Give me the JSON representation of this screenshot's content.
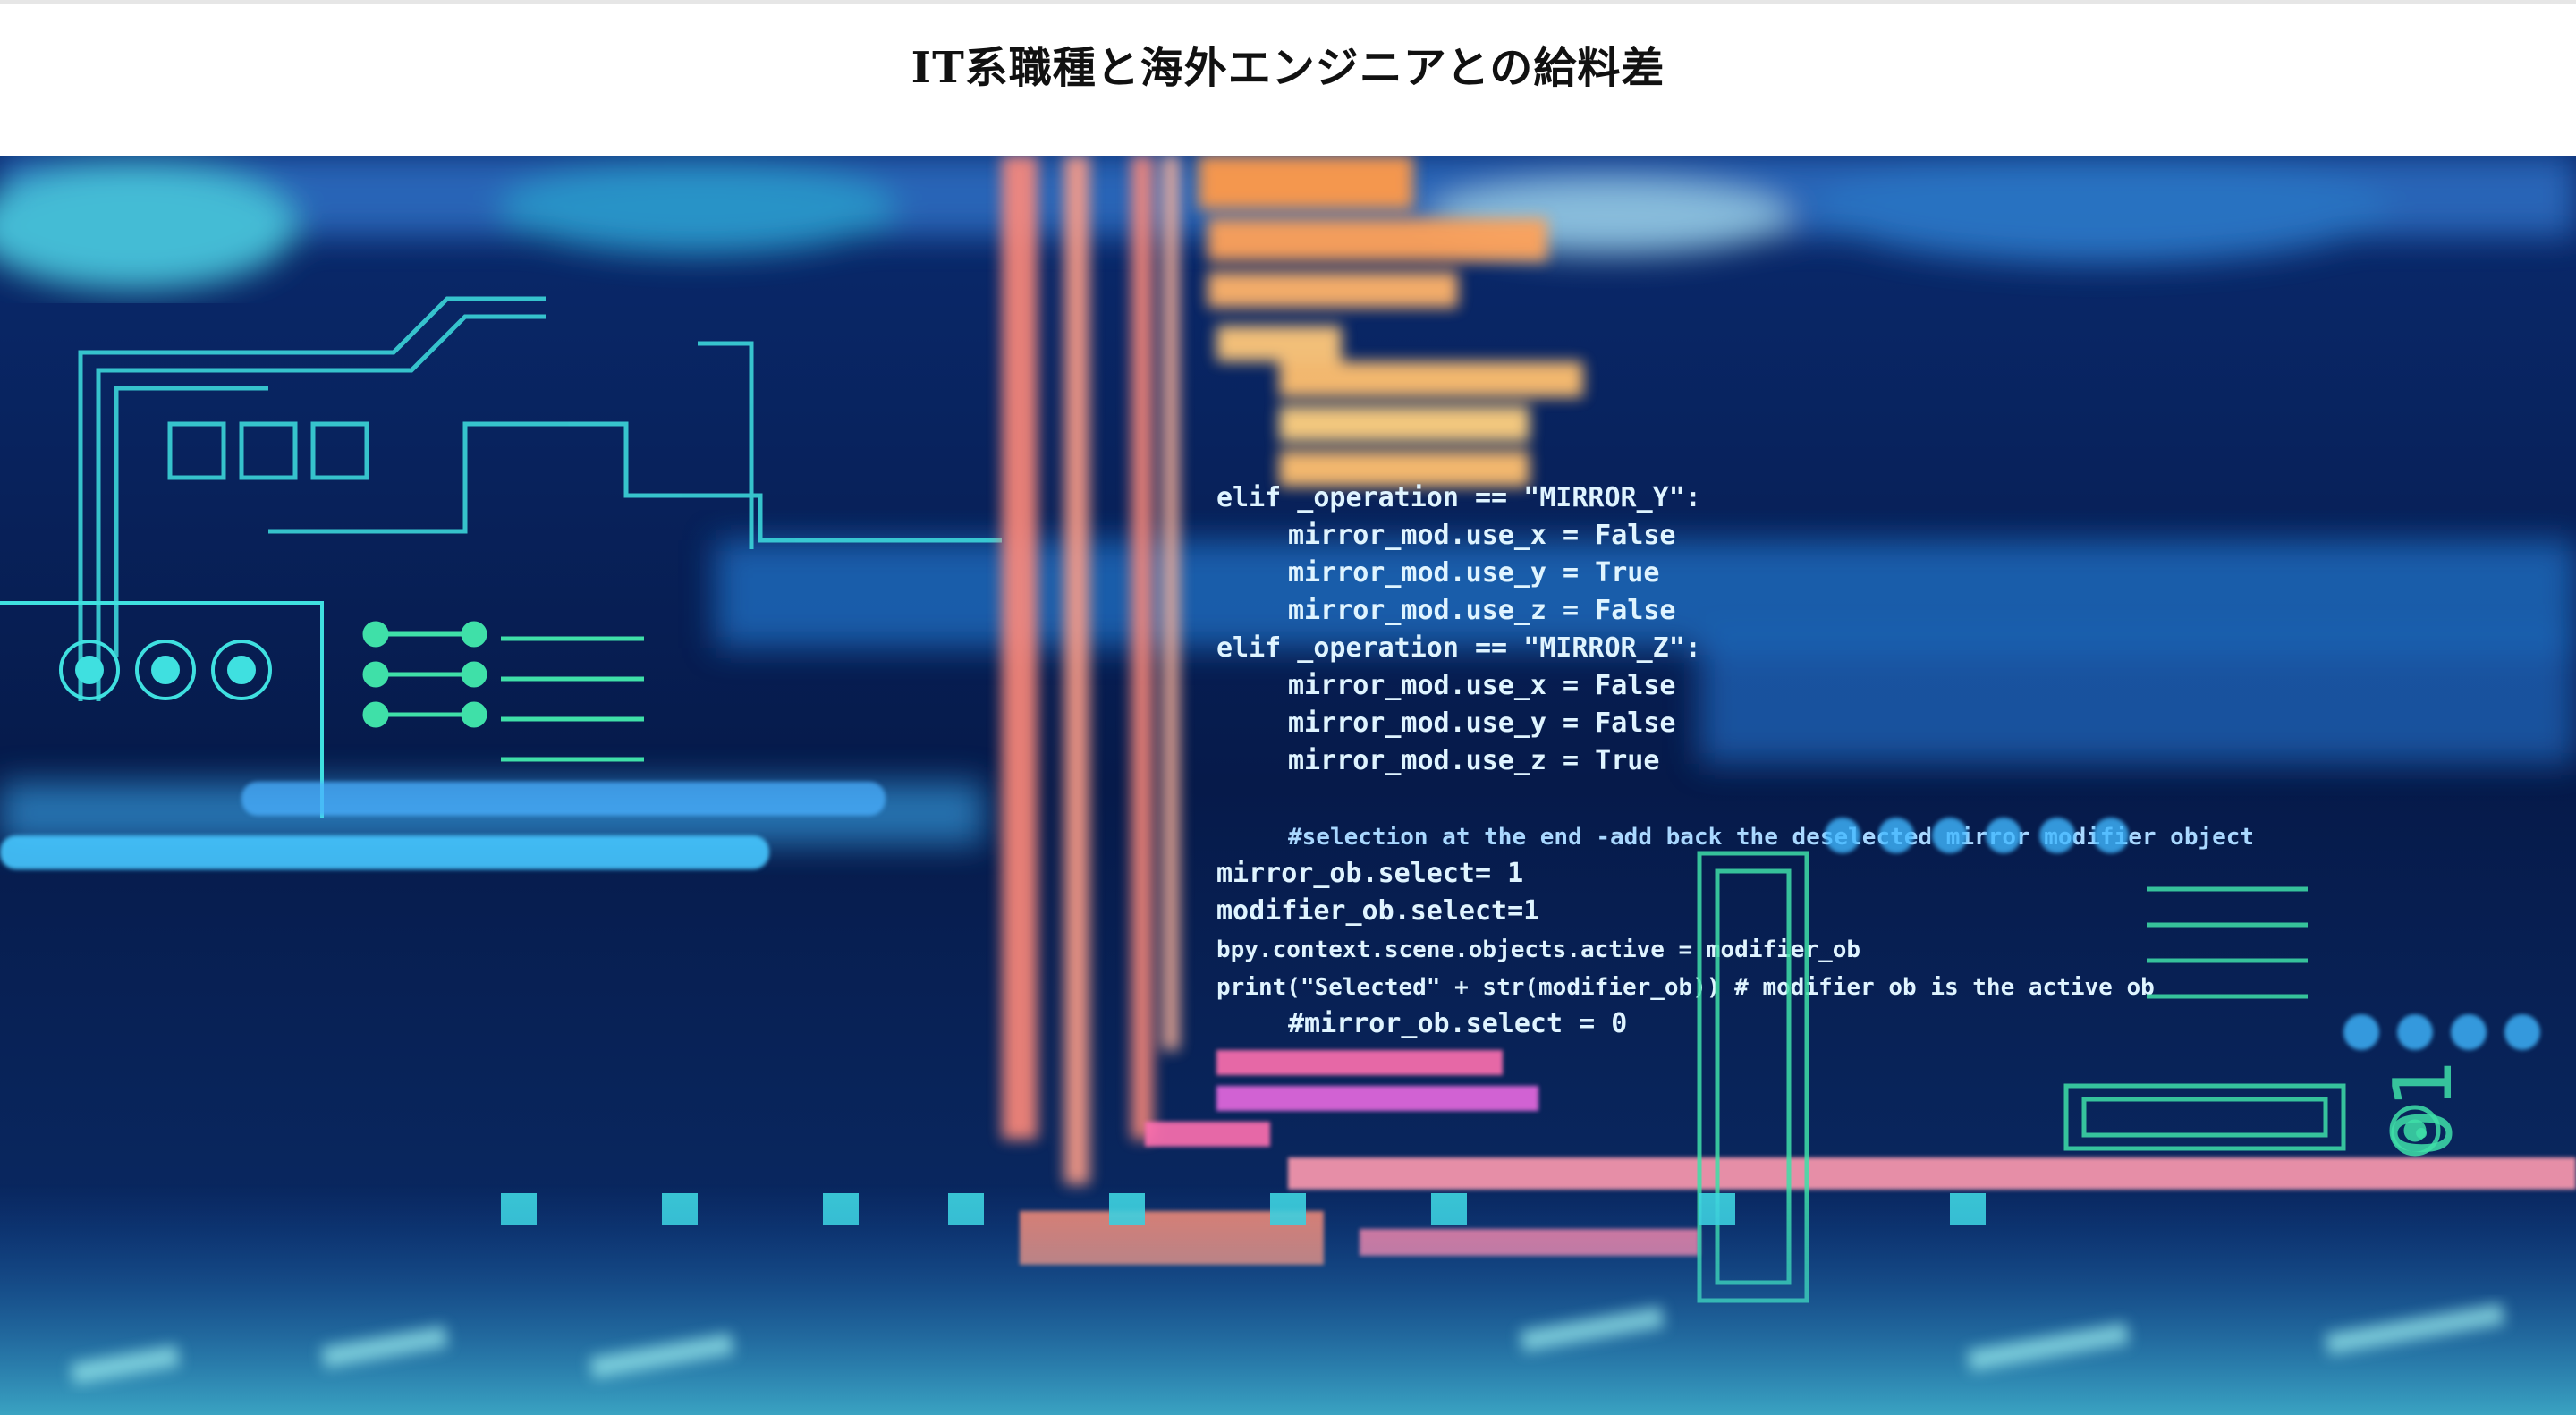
{
  "article": {
    "title": "IT系職種と海外エンジニアとの給料差"
  },
  "hero_image": {
    "icon": "code-screen-illustration",
    "code_lines": [
      "elif _operation == \"MIRROR_Y\":",
      "mirror_mod.use_x = False",
      "mirror_mod.use_y = True",
      "mirror_mod.use_z = False",
      "elif _operation == \"MIRROR_Z\":",
      "mirror_mod.use_x = False",
      "mirror_mod.use_y = False",
      "mirror_mod.use_z = True",
      "#selection at the end -add back the deselected mirror modifier object",
      "mirror_ob.select= 1",
      "modifier_ob.select=1",
      "bpy.context.scene.objects.active = modifier_ob",
      "print(\"Selected\" + str(modifier_ob)) # modifier ob is the active ob",
      "#mirror_ob.select = 0"
    ],
    "colors": {
      "background": "#061a4a",
      "cyan": "#3fe0e0",
      "orange": "#ff9a4a",
      "pink": "#ff6fb0",
      "white_text": "#dff4ff"
    }
  }
}
